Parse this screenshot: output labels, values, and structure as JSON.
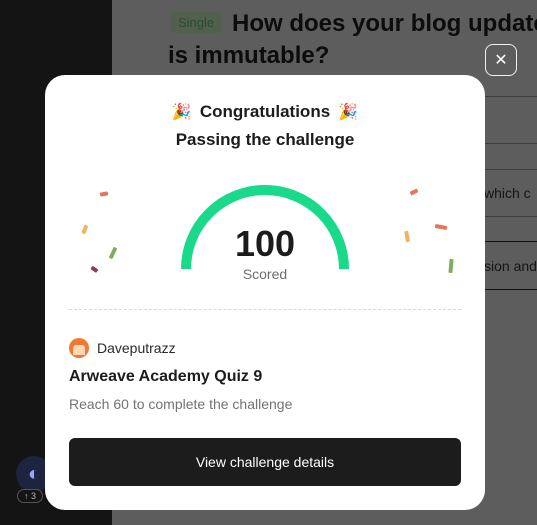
{
  "background": {
    "question_type": "Single",
    "question_title": "How does your blog update is immutable?",
    "option_fragment_1": "which c",
    "option_fragment_2": "sion and",
    "close_glyph": "✕",
    "badge_text": "↑ 3"
  },
  "modal": {
    "heading": "Congratulations",
    "subheading": "Passing the challenge",
    "emoji": "🎉",
    "score": "100",
    "score_label": "Scored",
    "progress": 1.0,
    "author": "Daveputrazz",
    "quiz_title": "Arweave Academy Quiz 9",
    "quiz_desc": "Reach 60 to complete the challenge",
    "cta_label": "View challenge details",
    "colors": {
      "gauge": "#19d98a",
      "cta_bg": "#1c1c1c"
    }
  }
}
